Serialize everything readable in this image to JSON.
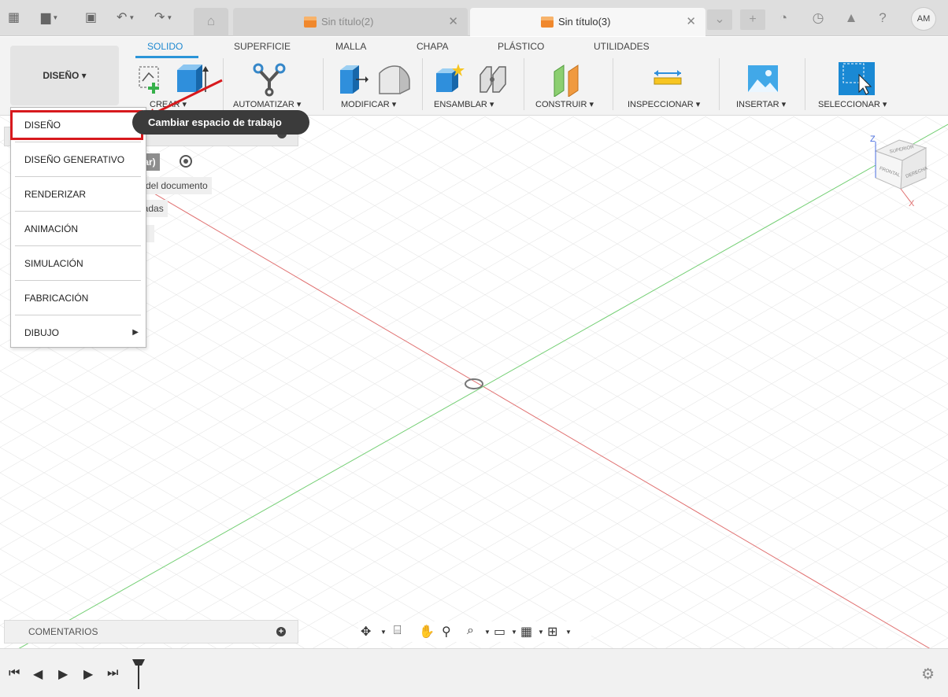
{
  "titlebar": {
    "tabs": [
      {
        "label": "Sin título(2)"
      },
      {
        "label": "Sin título(3)"
      }
    ],
    "user_initials": "AM"
  },
  "ribbon": {
    "workspace_button": "DISEÑO ▾",
    "tabs": [
      "SOLIDO",
      "SUPERFICIE",
      "MALLA",
      "CHAPA",
      "PLÁSTICO",
      "UTILIDADES"
    ],
    "active_tab": "SOLIDO",
    "groups": [
      "CREAR ▾",
      "AUTOMATIZAR ▾",
      "MODIFICAR ▾",
      "ENSAMBLAR ▾",
      "CONSTRUIR ▾",
      "INSPECCIONAR ▾",
      "INSERTAR ▾",
      "SELECCIONAR ▾"
    ]
  },
  "workspace_menu": {
    "items": [
      "DISEÑO",
      "DISEÑO GENERATIVO",
      "RENDERIZAR",
      "ANIMACIÓN",
      "SIMULACIÓN",
      "FABRICACIÓN",
      "DIBUJO"
    ],
    "highlighted": "DISEÑO"
  },
  "tooltip": "Cambiar espacio de trabajo",
  "browser": {
    "fragments": [
      "dar)",
      "n del documento",
      "dadas"
    ]
  },
  "viewcube": {
    "axis_z": "Z",
    "axis_x": "X",
    "faces": [
      "SUPERIOR",
      "FRONTAL",
      "DERECHA"
    ]
  },
  "comments": {
    "label": "COMENTARIOS"
  },
  "colors": {
    "accent": "#2b95d8",
    "highlight_box": "#d7191d",
    "tab_cube": "#f0882d",
    "x_axis": "#e05050",
    "y_axis": "#53c653"
  },
  "icons": [
    "grid-menu-icon",
    "file-icon",
    "save-icon",
    "undo-icon",
    "redo-icon",
    "home-icon",
    "add-tab-icon",
    "sync-icon",
    "clock-icon",
    "bell-icon",
    "help-icon",
    "settings-gear-icon"
  ]
}
